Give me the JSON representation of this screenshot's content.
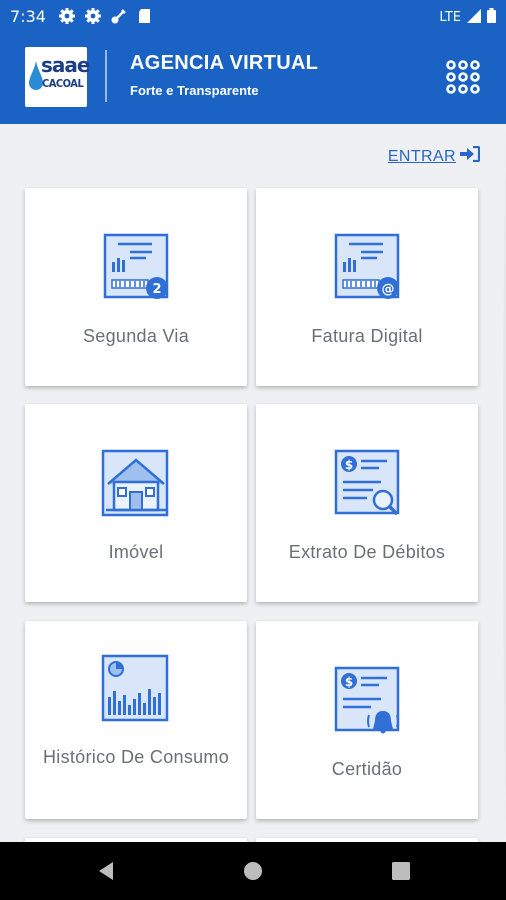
{
  "status_bar": {
    "time": "7:34",
    "network": "LTE",
    "icons": [
      "gear-icon",
      "gear-icon",
      "key-icon",
      "sd-card-icon",
      "signal-icon",
      "battery-icon"
    ]
  },
  "header": {
    "logo_brand": "saae",
    "logo_sub": "CACOAL",
    "title": "AGENCIA VIRTUAL",
    "subtitle": "Forte e Transparente",
    "menu_icon": "apps-grid-icon"
  },
  "login": {
    "label": "ENTRAR",
    "icon": "sign-in-icon"
  },
  "tiles": [
    {
      "label": "Segunda Via",
      "icon": "invoice-copy-icon"
    },
    {
      "label": "Fatura Digital",
      "icon": "invoice-email-icon"
    },
    {
      "label": "Imóvel",
      "icon": "house-icon"
    },
    {
      "label": "Extrato De Débitos",
      "icon": "debt-statement-icon"
    },
    {
      "label": "Histórico De Consumo",
      "icon": "consumption-chart-icon"
    },
    {
      "label": "Certidão",
      "icon": "certificate-alert-icon"
    }
  ],
  "colors": {
    "primary": "#1a63c5",
    "icon_blue": "#2f6fd6",
    "icon_fill": "#d9e6fa",
    "background": "#eef0f3"
  },
  "nav_bar": {
    "icons": [
      "back-icon",
      "home-icon",
      "recents-icon"
    ]
  }
}
